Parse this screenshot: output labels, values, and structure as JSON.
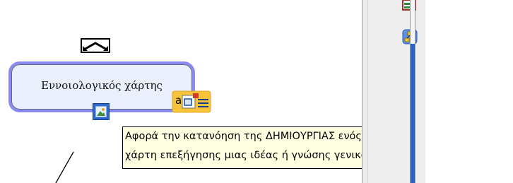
{
  "concept": {
    "label": "Εννοιολογικός χάρτης"
  },
  "tooltip": {
    "line1": "Αφορά την κατανόηση της ΔΗΜΙΟΥΡΓΙΑΣ ενός",
    "line2": "χάρτη επεξήγησης μιας ιδέας ή γνώσης γενικότερα"
  },
  "icons": {
    "collapse": "collapse-arrows-icon",
    "image": "image-icon",
    "annotation": "annotation-icon",
    "toolbar_top": "table-icon",
    "toolbar_second": "hierarchy-icon"
  },
  "colors": {
    "concept_border": "#8a8af2",
    "concept_fill": "#e9f0fb",
    "tooltip_bg": "#ffffe1",
    "scroll_thumb": "#2a63c6"
  }
}
